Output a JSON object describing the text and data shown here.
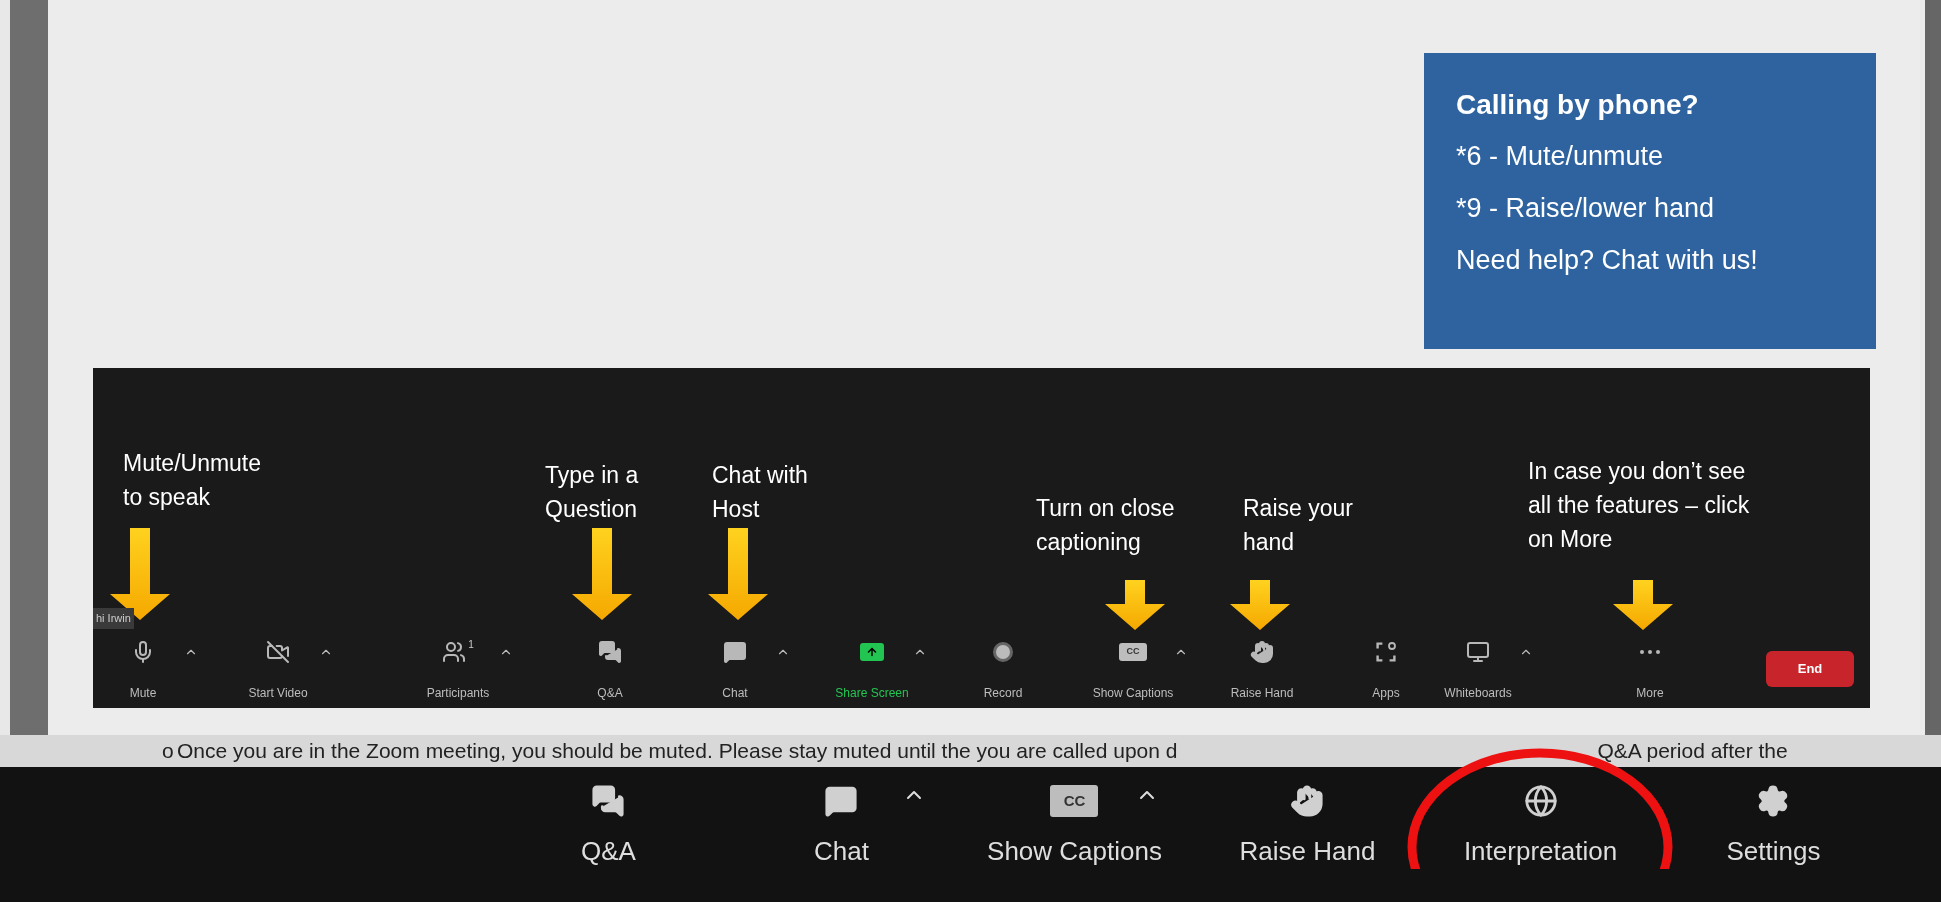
{
  "phone_box": {
    "title": "Calling by phone?",
    "lines": [
      "*6 - Mute/unmute",
      "*9 - Raise/lower hand",
      "Need help? Chat with us!"
    ]
  },
  "annotations": [
    "Mute/Unmute to speak",
    "Type in a Question",
    "Chat with Host",
    "Turn on close captioning",
    "Raise your hand",
    "In case you don’t see all the features – click on More"
  ],
  "name_tag": "hi Irwin",
  "meeting_toolbar": [
    {
      "kind": "mute",
      "label": "Mute",
      "caret": true
    },
    {
      "kind": "video",
      "label": "Start Video",
      "caret": true
    },
    {
      "kind": "participants",
      "label": "Participants",
      "count": "1",
      "caret": true
    },
    {
      "kind": "qa",
      "label": "Q&A",
      "caret": false
    },
    {
      "kind": "chat",
      "label": "Chat",
      "caret": true
    },
    {
      "kind": "share",
      "label": "Share Screen",
      "caret": true
    },
    {
      "kind": "record",
      "label": "Record",
      "caret": false
    },
    {
      "kind": "captions",
      "label": "Show Captions",
      "icon_text": "CC",
      "caret": true
    },
    {
      "kind": "hand",
      "label": "Raise Hand",
      "caret": false
    },
    {
      "kind": "apps",
      "label": "Apps",
      "caret": false
    },
    {
      "kind": "whiteboard",
      "label": "Whiteboards",
      "caret": true
    },
    {
      "kind": "more",
      "label": "More",
      "caret": false
    },
    {
      "kind": "end",
      "label": "End"
    }
  ],
  "bullet": {
    "marker": "o",
    "texts": [
      "Once you are in the Zoom meeting, you should be muted. Please stay muted until the you are called upon d",
      "Q&A period after the"
    ]
  },
  "bottom_toolbar": [
    {
      "kind": "qa",
      "label": "Q&A",
      "caret": false,
      "circled": false
    },
    {
      "kind": "chat",
      "label": "Chat",
      "caret": true,
      "circled": false
    },
    {
      "kind": "captions",
      "label": "Show Captions",
      "icon_text": "CC",
      "caret": true,
      "circled": false
    },
    {
      "kind": "hand",
      "label": "Raise Hand",
      "caret": false,
      "circled": false
    },
    {
      "kind": "globe",
      "label": "Interpretation",
      "caret": false,
      "circled": true
    },
    {
      "kind": "settings",
      "label": "Settings",
      "caret": false,
      "circled": false
    }
  ]
}
